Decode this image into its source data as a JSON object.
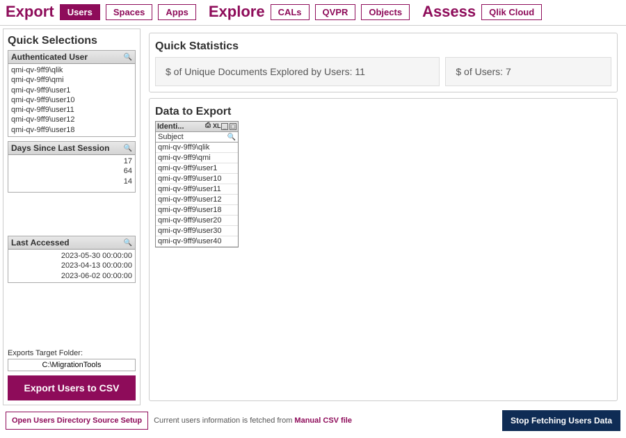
{
  "nav": {
    "export": {
      "title": "Export",
      "users": "Users",
      "spaces": "Spaces",
      "apps": "Apps"
    },
    "explore": {
      "title": "Explore",
      "cals": "CALs",
      "qvpr": "QVPR",
      "objects": "Objects"
    },
    "assess": {
      "title": "Assess",
      "qlikcloud": "Qlik Cloud"
    }
  },
  "quick_selections": {
    "title": "Quick Selections",
    "auth_user": {
      "header": "Authenticated User",
      "rows": [
        "qmi-qv-9ff9\\qlik",
        "qmi-qv-9ff9\\qmi",
        "qmi-qv-9ff9\\user1",
        "qmi-qv-9ff9\\user10",
        "qmi-qv-9ff9\\user11",
        "qmi-qv-9ff9\\user12",
        "qmi-qv-9ff9\\user18"
      ]
    },
    "days": {
      "header": "Days Since Last Session",
      "rows": [
        "17",
        "64",
        "14"
      ]
    },
    "last_accessed": {
      "header": "Last Accessed",
      "rows": [
        "2023-05-30 00:00:00",
        "2023-04-13 00:00:00",
        "2023-06-02 00:00:00"
      ]
    }
  },
  "exports": {
    "target_label": "Exports Target Folder:",
    "target_value": "C:\\MigrationTools",
    "button": "Export Users to CSV"
  },
  "stats": {
    "title": "Quick Statistics",
    "docs_label": "$ of Unique Documents Explored by Users: ",
    "docs_value": "11",
    "users_label": "$ of Users: ",
    "users_value": "7"
  },
  "data_export": {
    "title": "Data to Export",
    "table": {
      "header": "Identi...",
      "subheader": "Subject",
      "xlsym": "XL",
      "rows": [
        "qmi-qv-9ff9\\qlik",
        "qmi-qv-9ff9\\qmi",
        "qmi-qv-9ff9\\user1",
        "qmi-qv-9ff9\\user10",
        "qmi-qv-9ff9\\user11",
        "qmi-qv-9ff9\\user12",
        "qmi-qv-9ff9\\user18",
        "qmi-qv-9ff9\\user20",
        "qmi-qv-9ff9\\user30",
        "qmi-qv-9ff9\\user40"
      ]
    }
  },
  "bottom": {
    "open_setup": "Open Users Directory Source Setup",
    "info_pre": "Current users information is fetched from ",
    "info_hl": "Manual CSV file",
    "stop": "Stop Fetching Users Data"
  }
}
